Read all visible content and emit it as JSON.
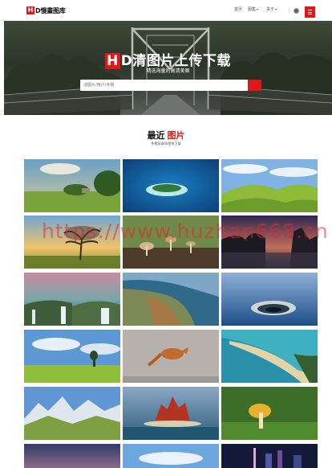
{
  "header": {
    "logo_mark": "H",
    "logo_text": "D慢畫图库",
    "nav": [
      {
        "label": "首页",
        "chevron": ""
      },
      {
        "label": "图集",
        "chevron": "▾"
      },
      {
        "label": "关于",
        "chevron": "▾"
      }
    ]
  },
  "hero": {
    "title_badge": "H",
    "title_rest": "D清图片上传下载",
    "subtitle": "精选海量的高清美图",
    "search_placeholder": "搜图片/用户/专题"
  },
  "section": {
    "title": "最近",
    "title_highlight": "图片",
    "subtitle": "免费高清4K壁纸下载"
  },
  "watermark": "https://www.huzhan668.cn",
  "images": [
    {
      "subject": "green meadow with clouds and house"
    },
    {
      "subject": "aerial island in blue sea"
    },
    {
      "subject": "rolling green hills under blue sky"
    },
    {
      "subject": "lone tree on plain at sunset"
    },
    {
      "subject": "small mushrooms on forest floor"
    },
    {
      "subject": "tree-lined lake at dusk"
    },
    {
      "subject": "waterfalls under pink sunset sky"
    },
    {
      "subject": "coastal rock cliffs and sea"
    },
    {
      "subject": "spillway hole in a calm lake"
    },
    {
      "subject": "green field with clouds"
    },
    {
      "subject": "leaping fox in snow"
    },
    {
      "subject": "sandbar spit in turquoise sea"
    },
    {
      "subject": "snowy mountains with alpine meadow"
    },
    {
      "subject": "red rock geyser in lake"
    },
    {
      "subject": "mushroom on mossy ground"
    },
    {
      "subject": "sky at dusk"
    },
    {
      "subject": "blue sky and clouds"
    },
    {
      "subject": "city skyline at night"
    }
  ]
}
